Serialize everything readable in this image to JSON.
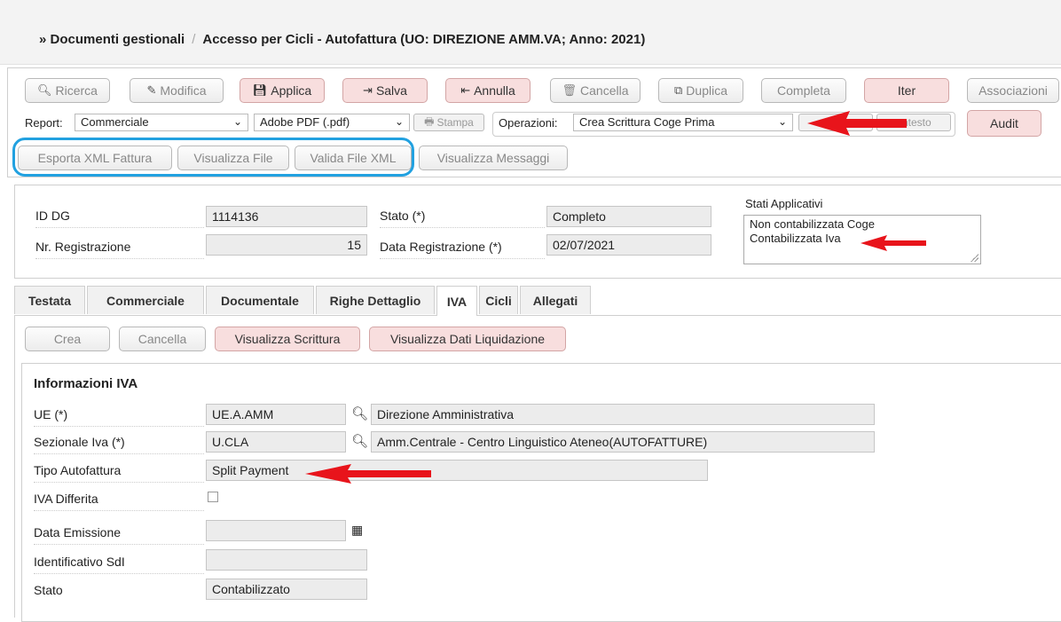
{
  "breadcrumb": {
    "root": "» Documenti gestionali",
    "separator": "/",
    "current": "Accesso per Cicli - Autofattura (UO: DIREZIONE AMM.VA; Anno: 2021)"
  },
  "toolbar": {
    "ricerca": "Ricerca",
    "modifica": "Modifica",
    "applica": "Applica",
    "salva": "Salva",
    "annulla": "Annulla",
    "cancella": "Cancella",
    "duplica": "Duplica",
    "completa": "Completa",
    "iter": "Iter",
    "associazioni": "Associazioni",
    "audit": "Audit"
  },
  "report": {
    "label": "Report:",
    "value": "Commerciale",
    "format": "Adobe PDF (.pdf)",
    "stampa": "Stampa"
  },
  "operazioni": {
    "label": "Operazioni:",
    "value": "Crea Scrittura Coge Prima",
    "contesto": "ontesto"
  },
  "actions": {
    "esporta_xml": "Esporta XML Fattura",
    "visualizza_file": "Visualizza File",
    "valida_xml": "Valida File XML",
    "visualizza_messaggi": "Visualizza Messaggi"
  },
  "header_fields": {
    "id_dg_label": "ID DG",
    "id_dg": "1114136",
    "nr_reg_label": "Nr. Registrazione",
    "nr_reg": "15",
    "stato_label": "Stato (*)",
    "stato": "Completo",
    "data_reg_label": "Data Registrazione (*)",
    "data_reg": "02/07/2021",
    "stati_label": "Stati Applicativi",
    "stati_line1": "Non contabilizzata Coge",
    "stati_line2": "Contabilizzata Iva"
  },
  "tabs": [
    "Testata",
    "Commerciale",
    "Documentale",
    "Righe Dettaglio",
    "IVA",
    "Cicli",
    "Allegati"
  ],
  "iva_actions": {
    "crea": "Crea",
    "cancella": "Cancella",
    "visualizza_scrittura": "Visualizza Scrittura",
    "visualizza_dati": "Visualizza Dati Liquidazione"
  },
  "iva": {
    "title": "Informazioni IVA",
    "ue_label": "UE (*)",
    "ue_code": "UE.A.AMM",
    "ue_desc": "Direzione Amministrativa",
    "sez_label": "Sezionale Iva (*)",
    "sez_code": "U.CLA",
    "sez_desc": "Amm.Centrale - Centro Linguistico Ateneo(AUTOFATTURE)",
    "tipo_label": "Tipo Autofattura",
    "tipo": "Split Payment",
    "differita_label": "IVA Differita",
    "data_emissione_label": "Data Emissione",
    "data_emissione": "",
    "sdi_label": "Identificativo SdI",
    "sdi": "",
    "stato_label": "Stato",
    "stato": "Contabilizzato"
  },
  "colors": {
    "highlight_ring": "#22a1e0",
    "annotation_arrow": "#e8141b",
    "pink_button": "#f8dede"
  }
}
